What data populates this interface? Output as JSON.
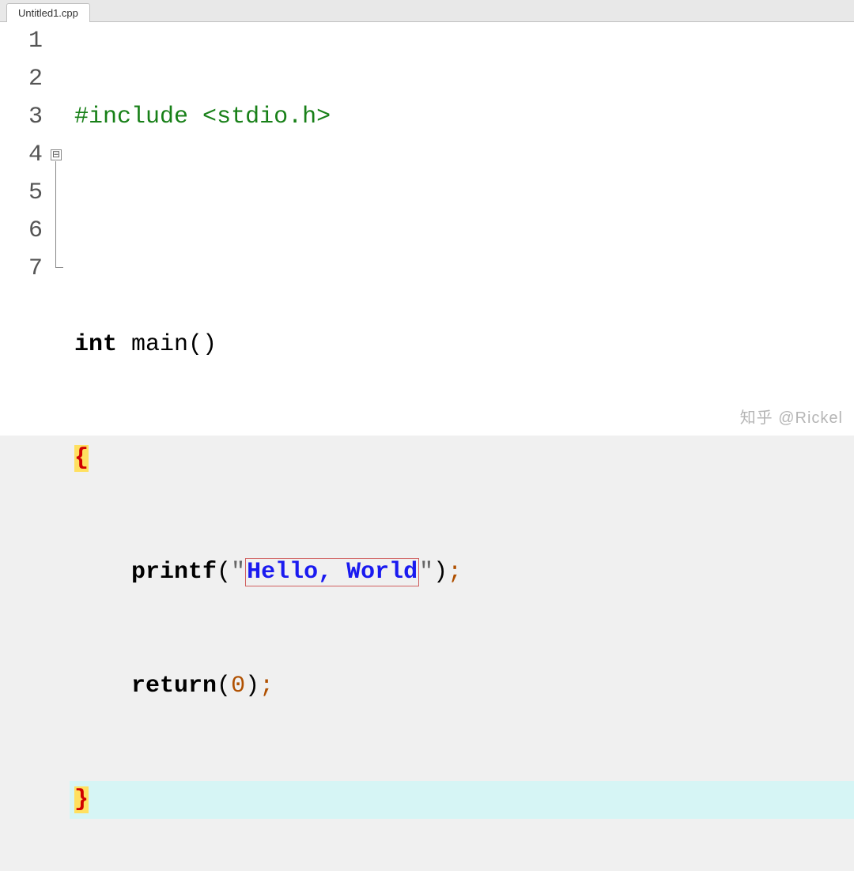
{
  "tab": {
    "label": "Untitled1.cpp"
  },
  "gutter": {
    "l1": "1",
    "l2": "2",
    "l3": "3",
    "l4": "4",
    "l5": "5",
    "l6": "6",
    "l7": "7"
  },
  "fold": {
    "marker": "⊟"
  },
  "code": {
    "l1": {
      "include": "#include",
      "space": " ",
      "lt": "<",
      "hdr": "stdio.h",
      "gt": ">"
    },
    "l3": {
      "kw": "int",
      "space": " ",
      "fn": "main",
      "lp": "(",
      "rp": ")"
    },
    "l4": {
      "brace": "{"
    },
    "l5": {
      "indent": "    ",
      "fn": "printf",
      "lp": "(",
      "q1": "\"",
      "str": "Hello, World",
      "q2": "\"",
      "rp": ")",
      "semi": ";"
    },
    "l6": {
      "indent": "    ",
      "kw": "return",
      "lp": "(",
      "num": "0",
      "rp": ")",
      "semi": ";"
    },
    "l7": {
      "brace": "}"
    }
  },
  "watermark": "知乎 @Rickel"
}
